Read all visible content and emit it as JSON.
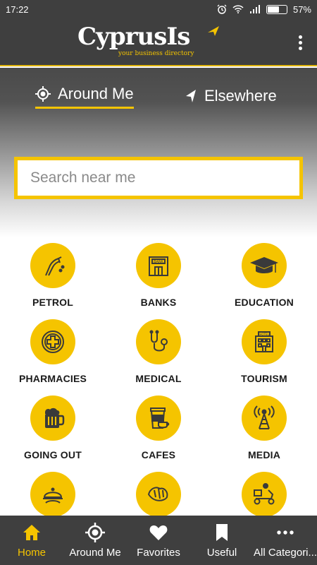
{
  "status_bar": {
    "time": "17:22",
    "battery_percent": "57%",
    "battery_level": 0.57,
    "icons": [
      "alarm-icon",
      "wifi-icon",
      "signal-icon",
      "battery-icon"
    ]
  },
  "app_bar": {
    "logo_text": "CyprusIs",
    "logo_tagline": "your business directory",
    "menu_icon": "more-vert-icon"
  },
  "tabs": [
    {
      "label": "Around Me",
      "icon": "crosshair-icon",
      "active": true
    },
    {
      "label": "Elsewhere",
      "icon": "navigation-arrow-icon",
      "active": false
    }
  ],
  "search": {
    "placeholder": "Search near me",
    "value": ""
  },
  "categories": [
    {
      "label": "PETROL",
      "icon": "fuel-nozzle-icon"
    },
    {
      "label": "BANKS",
      "icon": "bank-building-icon"
    },
    {
      "label": "EDUCATION",
      "icon": "graduation-cap-icon"
    },
    {
      "label": "PHARMACIES",
      "icon": "pharmacy-cross-icon"
    },
    {
      "label": "MEDICAL",
      "icon": "stethoscope-icon"
    },
    {
      "label": "TOURISM",
      "icon": "hotel-icon"
    },
    {
      "label": "GOING OUT",
      "icon": "beer-mug-icon"
    },
    {
      "label": "CAFES",
      "icon": "coffee-cup-icon"
    },
    {
      "label": "MEDIA",
      "icon": "broadcast-tower-icon"
    },
    {
      "label": "",
      "icon": "food-cloche-icon"
    },
    {
      "label": "",
      "icon": "bakery-icon"
    },
    {
      "label": "",
      "icon": "delivery-scooter-icon"
    }
  ],
  "bottom_nav": [
    {
      "label": "Home",
      "icon": "home-icon",
      "active": true
    },
    {
      "label": "Around Me",
      "icon": "crosshair-icon",
      "active": false
    },
    {
      "label": "Favorites",
      "icon": "heart-icon",
      "active": false
    },
    {
      "label": "Useful",
      "icon": "bookmark-icon",
      "active": false
    },
    {
      "label": "All Categori...",
      "icon": "more-horiz-icon",
      "active": false
    }
  ],
  "colors": {
    "accent": "#f5c400",
    "bar_bg": "#3f3f3f",
    "text_dark": "#1a1a1a"
  }
}
